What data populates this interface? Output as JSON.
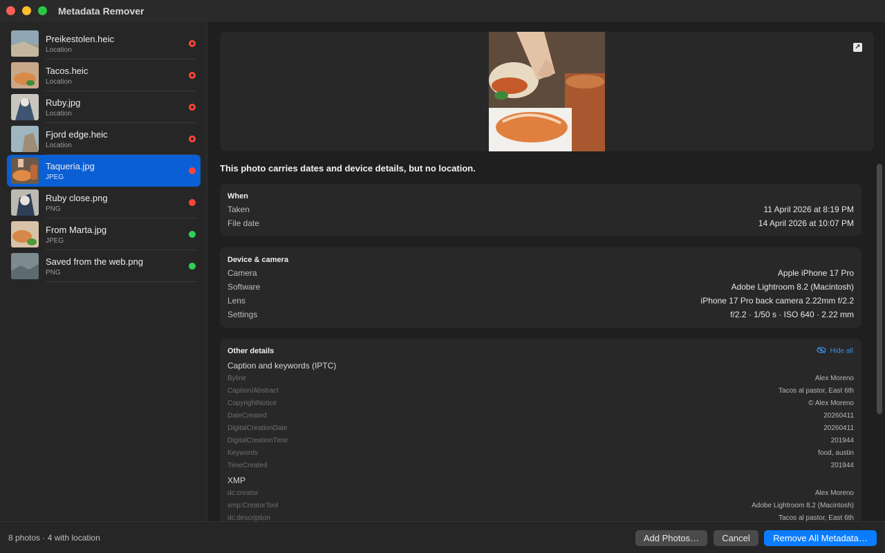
{
  "window": {
    "title": "Metadata Remover"
  },
  "sidebar": {
    "items": [
      {
        "name": "Preikestolen.heic",
        "type": "Location",
        "status": "location"
      },
      {
        "name": "Tacos.heic",
        "type": "Location",
        "status": "location"
      },
      {
        "name": "Ruby.jpg",
        "type": "Location",
        "status": "location"
      },
      {
        "name": "Fjord edge.heic",
        "type": "Location",
        "status": "location"
      },
      {
        "name": "Taqueria.jpg",
        "type": "JPEG",
        "status": "metadata"
      },
      {
        "name": "Ruby close.png",
        "type": "PNG",
        "status": "metadata"
      },
      {
        "name": "From Marta.jpg",
        "type": "JPEG",
        "status": "clean"
      },
      {
        "name": "Saved from the web.png",
        "type": "PNG",
        "status": "clean"
      }
    ],
    "selected_index": 4
  },
  "main": {
    "summary": "This photo carries dates and device details, but no location.",
    "when": {
      "title": "When",
      "rows": [
        {
          "label": "Taken",
          "value": "11 April 2026 at 8:19 PM"
        },
        {
          "label": "File date",
          "value": "14 April 2026 at 10:07 PM"
        }
      ]
    },
    "device": {
      "title": "Device & camera",
      "rows": [
        {
          "label": "Camera",
          "value": "Apple iPhone 17 Pro"
        },
        {
          "label": "Software",
          "value": "Adobe Lightroom 8.2 (Macintosh)"
        },
        {
          "label": "Lens",
          "value": "iPhone 17 Pro back camera 2.22mm f/2.2"
        },
        {
          "label": "Settings",
          "value": "f/2.2 · 1/50 s · ISO 640 · 2.22 mm"
        }
      ]
    },
    "other": {
      "title": "Other details",
      "hide_all": "Hide all",
      "iptc_title": "Caption and keywords (IPTC)",
      "iptc_rows": [
        {
          "label": "Byline",
          "value": "Alex Moreno"
        },
        {
          "label": "Caption/Abstract",
          "value": "Tacos al pastor, East 6th"
        },
        {
          "label": "CopyrightNotice",
          "value": "© Alex Moreno"
        },
        {
          "label": "DateCreated",
          "value": "20260411"
        },
        {
          "label": "DigitalCreationDate",
          "value": "20260411"
        },
        {
          "label": "DigitalCreationTime",
          "value": "201944"
        },
        {
          "label": "Keywords",
          "value": "food, austin"
        },
        {
          "label": "TimeCreated",
          "value": "201944"
        }
      ],
      "xmp_title": "XMP",
      "xmp_rows": [
        {
          "label": "dc:creator",
          "value": "Alex Moreno"
        },
        {
          "label": "xmp:CreatorTool",
          "value": "Adobe Lightroom 8.2 (Macintosh)"
        },
        {
          "label": "dc:description",
          "value": "Tacos al pastor, East 6th"
        }
      ]
    }
  },
  "footer": {
    "count": "8 photos · 4 with location",
    "add_label": "Add Photos…",
    "cancel_label": "Cancel",
    "remove_label": "Remove All Metadata…"
  },
  "colors": {
    "accent": "#0a7cff",
    "selected": "#0b5fd4",
    "location": "#ff453a",
    "clean": "#30d158"
  },
  "icons": {
    "expand": "expand-arrow-icon",
    "hide": "eye-slash-icon",
    "location": "location-pin-icon"
  }
}
